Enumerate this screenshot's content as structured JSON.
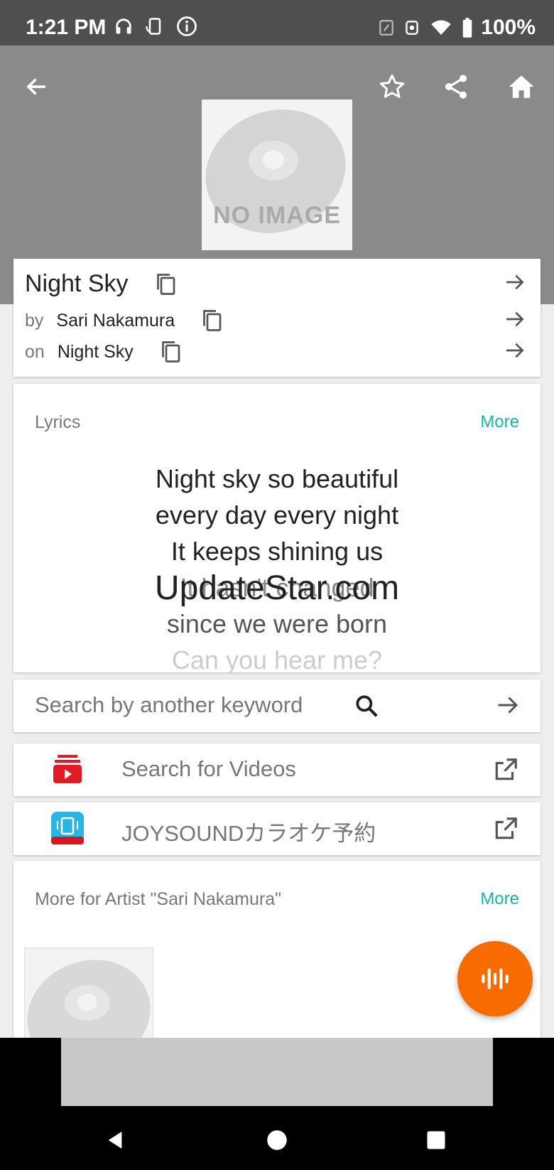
{
  "status_bar": {
    "time": "1:21 PM",
    "battery": "100%"
  },
  "track": {
    "title": "Night Sky",
    "artist_prefix": "by",
    "artist": "Sari Nakamura",
    "album_prefix": "on",
    "album": "Night Sky"
  },
  "cover": {
    "placeholder_text": "NO IMAGE"
  },
  "lyrics": {
    "label": "Lyrics",
    "more": "More",
    "lines": [
      "Night sky so beautiful",
      "every day every night",
      "It keeps shining us",
      "It hasn't changed",
      "since we were born",
      "Can you hear me?"
    ],
    "watermark": "UpdateStar.com"
  },
  "search": {
    "placeholder": "Search by another keyword"
  },
  "links": {
    "videos": "Search for Videos",
    "joysound": "JOYSOUNDカラオケ予約"
  },
  "artist_section": {
    "label": "More for Artist \"Sari Nakamura\"",
    "more": "More"
  },
  "colors": {
    "accent": "#1ab5a0",
    "fab": "#f76b00",
    "header": "#8a8a8a",
    "status_bar": "#4f4f4f"
  },
  "icons": {
    "back": "arrow-left-icon",
    "favorite": "star-outline-icon",
    "share": "share-icon",
    "home": "home-icon",
    "copy": "copy-icon",
    "forward": "arrow-right-icon",
    "search": "search-icon",
    "external": "open-in-new-icon",
    "fab": "audio-wave-icon"
  }
}
